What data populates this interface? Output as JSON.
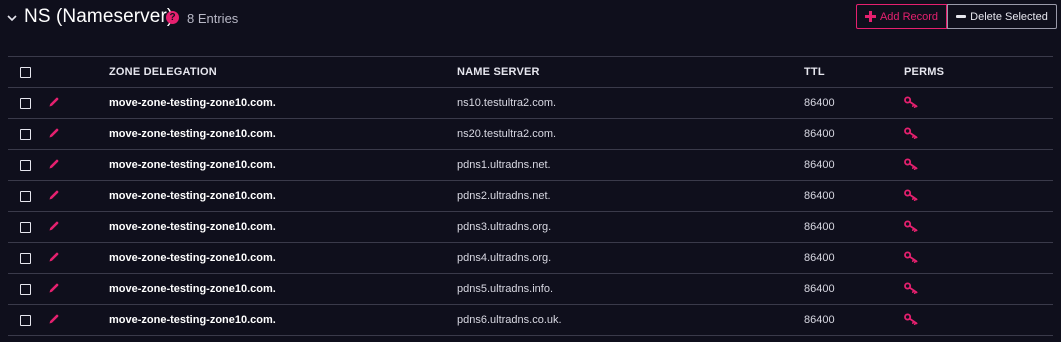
{
  "header": {
    "title": "NS (Nameserver)",
    "help_glyph": "?",
    "entries": "8 Entries",
    "add_record": "Add Record",
    "delete_selected": "Delete Selected"
  },
  "colors": {
    "accent": "#e5206f",
    "background": "#0f0f1c"
  },
  "icons": {
    "collapse": "chevron-down-icon",
    "help": "help-icon",
    "add": "plus-icon",
    "delete": "minus-icon",
    "edit": "pencil-icon",
    "perms": "key-icon"
  },
  "table": {
    "columns": [
      "ZONE DELEGATION",
      "NAME SERVER",
      "TTL",
      "PERMS"
    ],
    "rows": [
      {
        "zone": "move-zone-testing-zone10.com.",
        "ns": "ns10.testultra2.com.",
        "ttl": "86400"
      },
      {
        "zone": "move-zone-testing-zone10.com.",
        "ns": "ns20.testultra2.com.",
        "ttl": "86400"
      },
      {
        "zone": "move-zone-testing-zone10.com.",
        "ns": "pdns1.ultradns.net.",
        "ttl": "86400"
      },
      {
        "zone": "move-zone-testing-zone10.com.",
        "ns": "pdns2.ultradns.net.",
        "ttl": "86400"
      },
      {
        "zone": "move-zone-testing-zone10.com.",
        "ns": "pdns3.ultradns.org.",
        "ttl": "86400"
      },
      {
        "zone": "move-zone-testing-zone10.com.",
        "ns": "pdns4.ultradns.org.",
        "ttl": "86400"
      },
      {
        "zone": "move-zone-testing-zone10.com.",
        "ns": "pdns5.ultradns.info.",
        "ttl": "86400"
      },
      {
        "zone": "move-zone-testing-zone10.com.",
        "ns": "pdns6.ultradns.co.uk.",
        "ttl": "86400"
      }
    ]
  }
}
